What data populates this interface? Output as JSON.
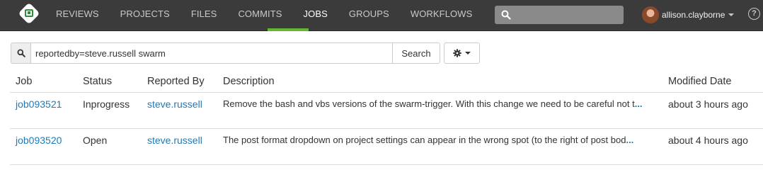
{
  "nav": {
    "items": [
      {
        "label": "REVIEWS",
        "active": false
      },
      {
        "label": "PROJECTS",
        "active": false
      },
      {
        "label": "FILES",
        "active": false
      },
      {
        "label": "COMMITS",
        "active": false
      },
      {
        "label": "JOBS",
        "active": true
      },
      {
        "label": "GROUPS",
        "active": false
      },
      {
        "label": "WORKFLOWS",
        "active": false
      }
    ],
    "username": "allison.clayborne",
    "help": "?"
  },
  "search": {
    "value": "reportedby=steve.russell swarm",
    "button_label": "Search"
  },
  "table": {
    "headers": {
      "job": "Job",
      "status": "Status",
      "reported_by": "Reported By",
      "description": "Description",
      "modified": "Modified Date"
    },
    "rows": [
      {
        "job": "job093521",
        "status": "Inprogress",
        "reported_by": "steve.russell",
        "description": "Remove the bash and vbs versions of the swarm-trigger. With this change we need to be careful not t",
        "more": "...",
        "modified": "about 3 hours ago"
      },
      {
        "job": "job093520",
        "status": "Open",
        "reported_by": "steve.russell",
        "description": "The post format dropdown on project settings can appear in the wrong spot (to the right of post bod",
        "more": "...",
        "modified": "about 4 hours ago"
      }
    ]
  },
  "colors": {
    "nav_bg": "#3b3b3b",
    "accent": "#62b832",
    "link": "#1f7ab8"
  }
}
